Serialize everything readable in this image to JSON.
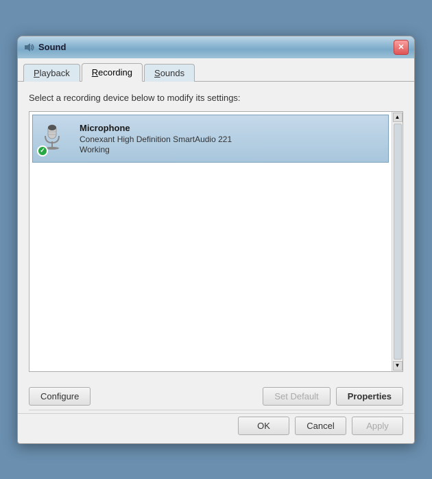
{
  "window": {
    "title": "Sound",
    "icon": "speaker"
  },
  "tabs": [
    {
      "id": "playback",
      "label": "Playback",
      "underline": "P",
      "active": false
    },
    {
      "id": "recording",
      "label": "Recording",
      "underline": "R",
      "active": true
    },
    {
      "id": "sounds",
      "label": "Sounds",
      "underline": "S",
      "active": false
    }
  ],
  "content": {
    "instruction": "Select a recording device below to modify its settings:",
    "devices": [
      {
        "name": "Microphone",
        "description": "Conexant High Definition SmartAudio 221",
        "status": "Working"
      }
    ]
  },
  "buttons": {
    "configure": "Configure",
    "set_default": "Set Default",
    "properties": "Properties",
    "ok": "OK",
    "cancel": "Cancel",
    "apply": "Apply"
  }
}
